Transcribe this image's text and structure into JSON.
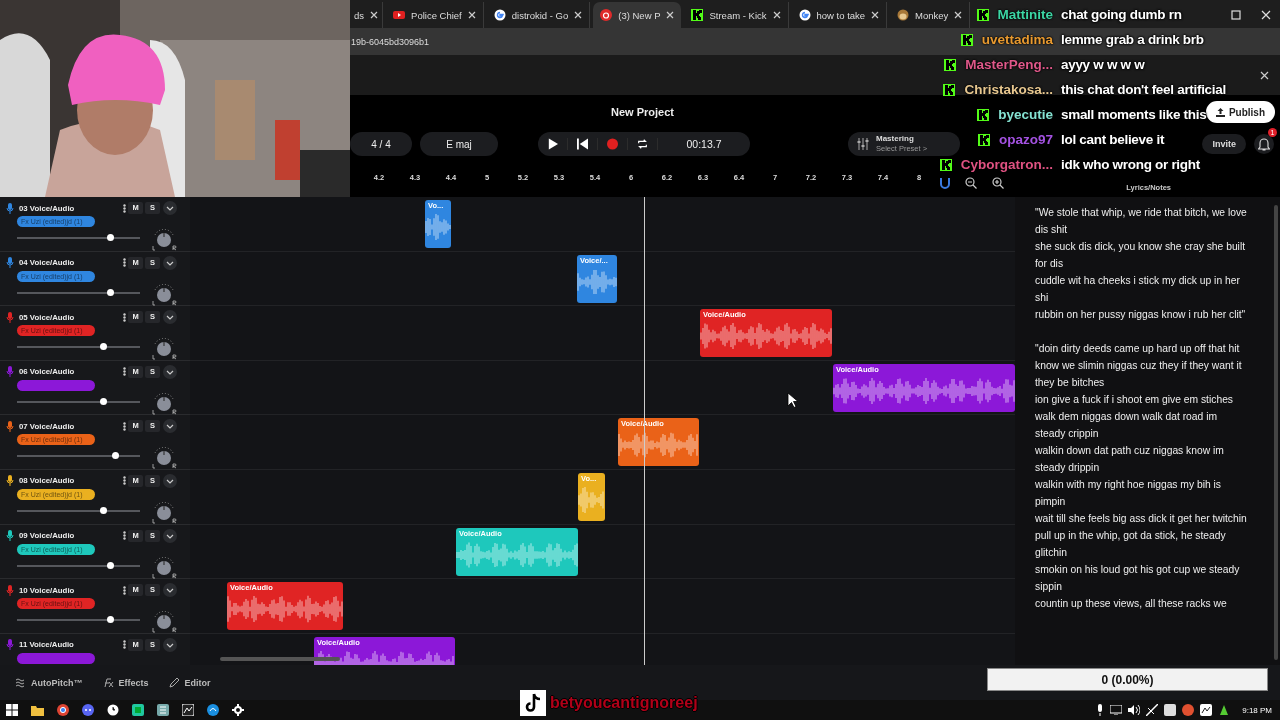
{
  "browser": {
    "tabs": [
      {
        "title": "ds",
        "selected": false
      },
      {
        "title": "Police Chief",
        "selected": false
      },
      {
        "title": "distrokid - Go",
        "selected": false
      },
      {
        "title": "(3) New P",
        "selected": true
      },
      {
        "title": "Stream - Kick",
        "selected": false
      },
      {
        "title": "how to take",
        "selected": false
      },
      {
        "title": "Monkey",
        "selected": false
      }
    ],
    "address": "19b-6045bd3096b1"
  },
  "daw": {
    "title": "New Project",
    "publish": "Publish",
    "time_signature": "4 / 4",
    "key": "E maj",
    "time": "00:13.7",
    "mastering": "Mastering",
    "preset": "Select Preset >",
    "invite": "Invite",
    "notifications": "1",
    "ruler": [
      "4.2",
      "4.3",
      "4.4",
      "5",
      "5.2",
      "5.3",
      "5.4",
      "6",
      "6.2",
      "6.3",
      "6.4",
      "7",
      "7.2",
      "7.3",
      "7.4",
      "8"
    ]
  },
  "tracks": [
    {
      "name": "03 Voice/Audio",
      "color": "#2f86e0",
      "fx": "Fx Uzi (edited)jd (1)",
      "level": 0.76,
      "clip": "Vo...",
      "mute": "M",
      "solo": "S"
    },
    {
      "name": "04 Voice/Audio",
      "color": "#2f86e0",
      "fx": "Fx Uzi (edited)jd (1)",
      "level": 0.76,
      "clip": "Voice/...",
      "mute": "M",
      "solo": "S"
    },
    {
      "name": "05 Voice/Audio",
      "color": "#e02424",
      "fx": "Fx Uzi (edited)jd (1)",
      "level": 0.7,
      "clip": "Voice/Audio",
      "mute": "M",
      "solo": "S"
    },
    {
      "name": "06 Voice/Audio",
      "color": "#8c18d8",
      "level": 0.7,
      "clip": "Voice/Audio",
      "mute": "M",
      "solo": "S"
    },
    {
      "name": "07 Voice/Audio",
      "color": "#ea6218",
      "fx": "Fx Uzi (edited)jd (1)",
      "level": 0.8,
      "clip": "Voice/Audio",
      "mute": "M",
      "solo": "S"
    },
    {
      "name": "08 Voice/Audio",
      "color": "#eab020",
      "fx": "Fx Uzi (edited)jd (1)",
      "level": 0.7,
      "clip": "Vo...",
      "mute": "M",
      "solo": "S"
    },
    {
      "name": "09 Voice/Audio",
      "color": "#1ec8bc",
      "fx": "Fx Uzi (edited)jd (1)",
      "level": 0.76,
      "clip": "Voice/Audio",
      "mute": "M",
      "solo": "S"
    },
    {
      "name": "10 Voice/Audio",
      "color": "#e02424",
      "fx": "Fx Uzi (edited)jd (1)",
      "level": 0.76,
      "clip": "Voice/Audio",
      "mute": "M",
      "solo": "S"
    },
    {
      "name": "11 Voice/Audio",
      "color": "#8c18d8",
      "clip": "Voice/Audio",
      "mute": "M",
      "solo": "S"
    }
  ],
  "lyrics": {
    "title": "Lyrics/Notes",
    "stanzas": [
      [
        "\"We stole that whip, we ride that bitch, we love dis shit",
        "she suck dis dick, you know she cray she built for dis",
        "cuddle wit ha cheeks i stick my dick up in her shi",
        "rubbin on her pussy niggas know i rub her clit\""
      ],
      [
        "\"doin dirty deeds came up hard up off that hit",
        "know we slimin niggas cuz they if they want it they be bitches",
        "ion give a fuck if i shoot em give em stiches",
        "walk dem niggas down walk dat road im steady crippin",
        "walkin down dat path cuz niggas know im steady drippin",
        "walkin with my right hoe niggas my bih is pimpin",
        "wait till she feels big ass dick it get her twitchin",
        "pull up in the whip, got da stick, he steady glitchin",
        "smokin on his loud got his got cup we steady sippin",
        "countin up these views, all these racks we"
      ]
    ]
  },
  "bottom_bar": {
    "tabs": [
      {
        "label": "AutoPitch™"
      },
      {
        "label": "Effects"
      },
      {
        "label": "Editor"
      }
    ]
  },
  "chat": [
    {
      "user": "Mattinite",
      "color": "#3cd6a4",
      "message": "chat going dumb rn"
    },
    {
      "user": "uvettadima",
      "color": "#e89a30",
      "message": "lemme grab a drink brb"
    },
    {
      "user": "MasterPeng...",
      "color": "#e0588a",
      "message": "ayyy w w w w"
    },
    {
      "user": "Christakosa...",
      "color": "#e8c890",
      "message": "this chat don't feel artificial"
    },
    {
      "user": "byecutie",
      "color": "#84e2d2",
      "message": "small moments like this"
    },
    {
      "user": "opazo97",
      "color": "#a452e2",
      "message": "lol cant believe it"
    },
    {
      "user": "Cyborgatron...",
      "color": "#e05282",
      "message": "idk who wrong or right"
    }
  ],
  "counter": "0 (0.00%)",
  "overlay_handle": "betyoucantignoreej",
  "taskbar": {
    "clock": "9:18 PM"
  }
}
